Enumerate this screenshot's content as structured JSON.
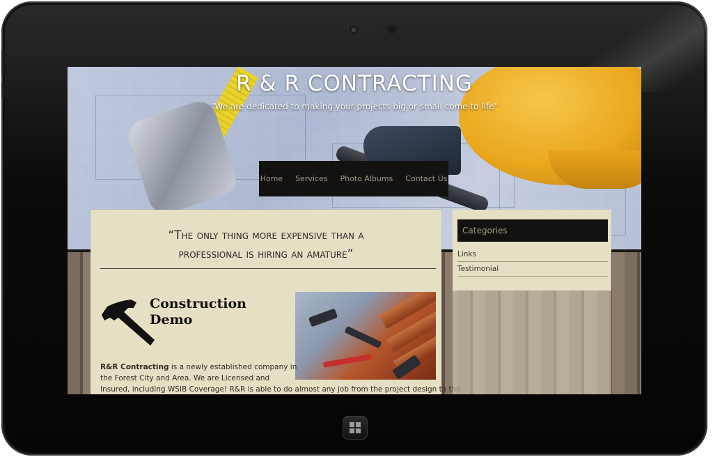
{
  "site": {
    "title": "R & R CONTRACTING",
    "tagline": "\"We are dedicated to making your projects big or small come to life\""
  },
  "nav": {
    "items": [
      {
        "label": "Home"
      },
      {
        "label": "Services"
      },
      {
        "label": "Photo Albums"
      },
      {
        "label": "Contact Us"
      }
    ]
  },
  "main": {
    "quote_line1": "“The only thing more expensive than a",
    "quote_line2": "professional is hiring an amature”",
    "post": {
      "title_line1": "Construction",
      "title_line2": "Demo",
      "lead": "R&R Contracting",
      "text_line1": " is a newly established company in",
      "text_line2": "the Forest City and Area. We are Licensed and",
      "text_line3": "Insured, including WSIB Coverage! R&R is able to do almost any job from the project design to the"
    }
  },
  "sidebar": {
    "categories_title": "Categories",
    "categories": [
      {
        "label": "Links"
      },
      {
        "label": "Testimonial"
      }
    ]
  },
  "icons": {
    "post_icon": "hammer-icon",
    "home_button": "windows-logo-icon",
    "camera": "camera-icon"
  },
  "colors": {
    "nav_bg": "#141210",
    "nav_text": "#a39884",
    "content_bg": "#e5e0c4",
    "title_text": "#ffffff"
  }
}
